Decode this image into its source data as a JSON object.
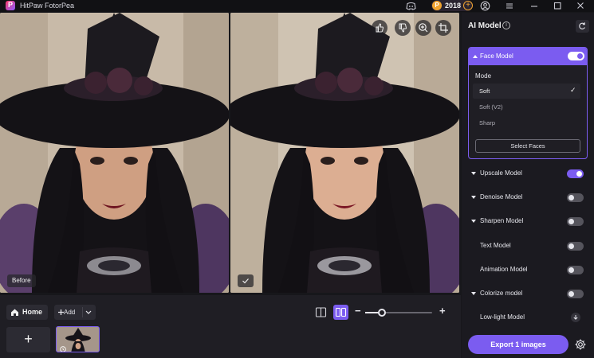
{
  "window": {
    "title": "HitPaw FotorPea",
    "points": "2018"
  },
  "preview": {
    "before_label": "Before"
  },
  "bottom": {
    "home_label": "Home",
    "add_label": "Add",
    "add_tile_symbol": "+",
    "zoom": 0.25
  },
  "panel": {
    "title": "AI Model",
    "face_model": {
      "label": "Face Model",
      "enabled": true,
      "mode_label": "Mode",
      "modes": [
        {
          "label": "Soft",
          "selected": true
        },
        {
          "label": "Soft (V2)",
          "selected": false
        },
        {
          "label": "Sharp",
          "selected": false
        }
      ],
      "select_faces_label": "Select Faces"
    },
    "models": [
      {
        "label": "Upscale Model",
        "expandable": true,
        "enabled": true,
        "control": "toggle"
      },
      {
        "label": "Denoise Model",
        "expandable": true,
        "enabled": false,
        "control": "toggle"
      },
      {
        "label": "Sharpen Model",
        "expandable": true,
        "enabled": false,
        "control": "toggle"
      },
      {
        "label": "Text Model",
        "expandable": false,
        "enabled": false,
        "control": "toggle"
      },
      {
        "label": "Animation Model",
        "expandable": false,
        "enabled": false,
        "control": "toggle"
      },
      {
        "label": "Colorize model",
        "expandable": true,
        "enabled": false,
        "control": "toggle"
      },
      {
        "label": "Low-light Model",
        "expandable": false,
        "enabled": false,
        "control": "download"
      }
    ],
    "export_label": "Export 1 images"
  },
  "colors": {
    "accent": "#7b5cf0",
    "panel_bg": "#1b1a20",
    "app_bg": "#17171b",
    "coin": "#f0a330"
  }
}
